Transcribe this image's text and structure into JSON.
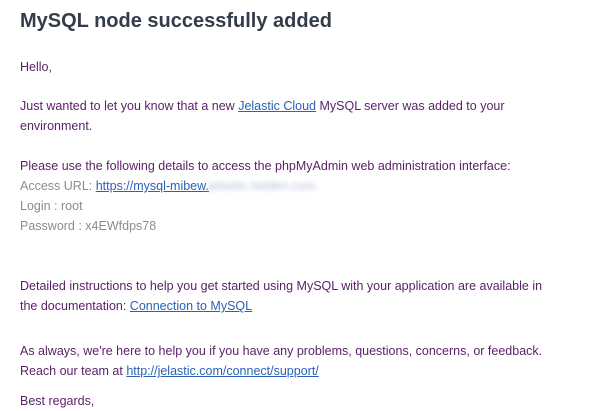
{
  "email": {
    "title": "MySQL node successfully added",
    "greeting": "Hello,",
    "intro": {
      "before": "Just wanted to let you know that a new ",
      "link": "Jelastic Cloud",
      "after_line1": " MySQL server was added to your",
      "line2": "environment."
    },
    "details_intro": "Please use the following details to access the phpMyAdmin web administration interface:",
    "access_url": {
      "label": "Access URL: ",
      "link": "https://mysql-mibew.",
      "blurred": "jelastic.hidden.com"
    },
    "login": "Login : root",
    "password": "Password : x4EWfdps78",
    "instructions": {
      "line1": "Detailed instructions to help you get started using MySQL with your application are available in",
      "line2_before": "the documentation: ",
      "link": "Connection to MySQL"
    },
    "support": {
      "line1": "As always, we're here to help you if you have any problems, questions, concerns, or feedback.",
      "line2_before": "Reach our team at ",
      "link": "http://jelastic.com/connect/support/"
    },
    "closing": "Best regards,"
  }
}
